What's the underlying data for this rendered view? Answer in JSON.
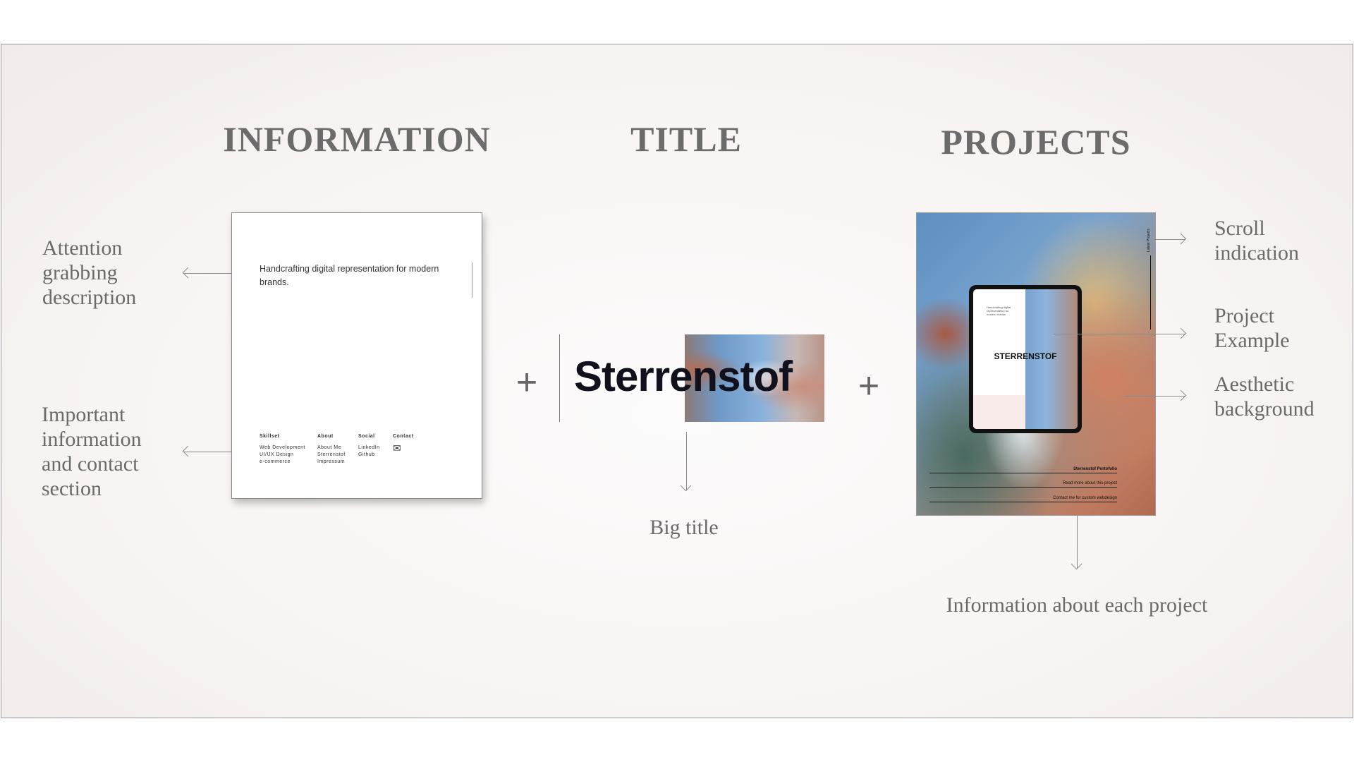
{
  "headings": {
    "information": "INFORMATION",
    "title": "TITLE",
    "projects": "PROJECTS"
  },
  "left_labels": {
    "attention": [
      "Attention",
      "grabbing",
      "description"
    ],
    "important": [
      "Important",
      "information",
      "and contact",
      "section"
    ]
  },
  "plus_sign": "+",
  "info_card": {
    "description": "Handcrafting digital representation for modern brands.",
    "columns": [
      {
        "heading": "Skillset",
        "items": [
          "Web Development",
          "UI/UX Design",
          "e-commerce"
        ]
      },
      {
        "heading": "About",
        "items": [
          "About Me",
          "Sterrenstof",
          "Impressum"
        ]
      },
      {
        "heading": "Social",
        "items": [
          "LinkedIn",
          "Github"
        ]
      },
      {
        "heading": "Contact",
        "items": [
          "✉"
        ]
      }
    ]
  },
  "title_block": {
    "text": "Sterrenstof",
    "caption": "Big title"
  },
  "projects_card": {
    "vertical_label": "Latest Projects",
    "tablet_title": "STERRENSTOF",
    "tablet_description": "Handcrafting digital representation for modern brands",
    "rows": [
      "Sterrenstof Portofolio",
      "Read more about this project",
      "Contact me for custom webdesign"
    ]
  },
  "right_labels": {
    "scroll": [
      "Scroll",
      "indication"
    ],
    "example": [
      "Project",
      "Example"
    ],
    "background": [
      "Aesthetic",
      "background"
    ]
  },
  "bottom_caption": "Information about each project",
  "colors": {
    "heading": "#6b6b6b",
    "label": "#6a6a6a",
    "title_text": "#10111c"
  }
}
